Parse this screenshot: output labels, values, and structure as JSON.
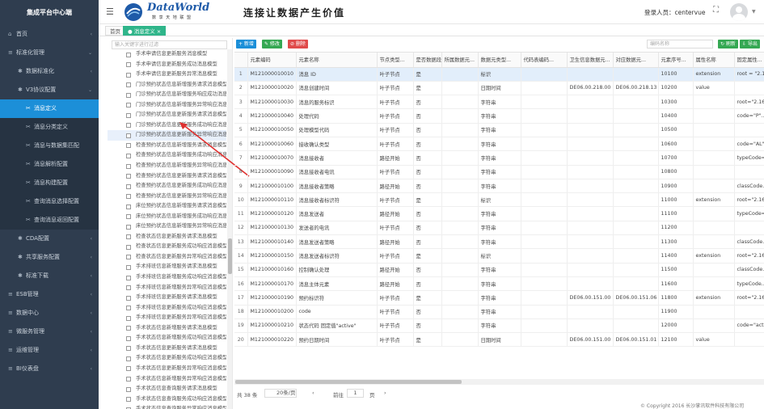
{
  "sidebar": {
    "brand": "集成平台中心端",
    "items": [
      {
        "label": "首页",
        "icon": "home-icon",
        "level": 1
      },
      {
        "label": "标准化管理",
        "icon": "list-icon",
        "level": 1,
        "expanded": true
      },
      {
        "label": "数据标准化",
        "icon": "gear-icon",
        "level": 2
      },
      {
        "label": "V3协议配置",
        "icon": "gear-icon",
        "level": 2,
        "expanded": true
      },
      {
        "label": "消息定义",
        "icon": "scissors-icon",
        "level": 3,
        "active": true
      },
      {
        "label": "消息分类定义",
        "icon": "scissors-icon",
        "level": 3
      },
      {
        "label": "消息与数据集匹配",
        "icon": "scissors-icon",
        "level": 3
      },
      {
        "label": "消息解析配置",
        "icon": "scissors-icon",
        "level": 3
      },
      {
        "label": "消息构建配置",
        "icon": "scissors-icon",
        "level": 3
      },
      {
        "label": "查询消息选择配置",
        "icon": "scissors-icon",
        "level": 3
      },
      {
        "label": "查询消息返回配置",
        "icon": "scissors-icon",
        "level": 3
      },
      {
        "label": "CDA配置",
        "icon": "gear-icon",
        "level": 2
      },
      {
        "label": "共享服务配置",
        "icon": "gear-icon",
        "level": 2
      },
      {
        "label": "标准下载",
        "icon": "gear-icon",
        "level": 2
      },
      {
        "label": "ESB管理",
        "icon": "list-icon",
        "level": 1
      },
      {
        "label": "数据中心",
        "icon": "list-icon",
        "level": 1
      },
      {
        "label": "微服务管理",
        "icon": "list-icon",
        "level": 1
      },
      {
        "label": "运维管理",
        "icon": "list-icon",
        "level": 1
      },
      {
        "label": "BI仪表盘",
        "icon": "list-icon",
        "level": 1
      }
    ]
  },
  "header": {
    "logo_text": "DataWorld",
    "logo_sub": "数 享 天 地 联 盟",
    "slogan": "连接让数据产生价值",
    "login_label": "登录人员：centervue"
  },
  "tabs": [
    {
      "label": "首页",
      "active": false
    },
    {
      "label": "● 消息定义 ×",
      "active": true
    }
  ],
  "tree": {
    "search_placeholder": "输入关键字进行过滤",
    "nodes": [
      "手术申请信息更新服务消息模型",
      "手术申请信息更新服务成功消息模型",
      "手术申请信息更新服务异常消息模型",
      "门诊预约状态信息新增服务请求消息模型",
      "门诊预约状态信息新增服务响应成功消息",
      "门诊预约状态信息新增服务异常响应消息",
      "门诊预约状态信息更新服务请求消息模型",
      "门诊预约状态信息更新服务成功响应消息",
      "门诊预约状态信息更新服务异常响应消息",
      "检查预约状态信息新增服务请求消息模型",
      "检查预约状态信息新增服务成功响应消息",
      "检查预约状态信息新增服务异常响应消息",
      "检查预约状态信息更新服务请求消息模型",
      "检查预约状态信息更新服务成功响应消息",
      "检查预约状态信息更新服务异常响应消息",
      "床位预约状态信息新增服务请求消息模型",
      "床位预约状态信息新增服务成功响应消息",
      "床位预约状态信息新增服务异常响应消息",
      "检查状态信息更新服务请求消息模型",
      "检查状态信息更新服务成功响应消息模型",
      "检查状态信息更新服务异常响应消息模型",
      "手术排班信息新增服务请求消息模型",
      "手术排班信息新增服务成功响应消息模型",
      "手术排班信息新增服务异常响应消息模型",
      "手术排班信息更新服务请求消息模型",
      "手术排班信息更新服务成功响应消息模型",
      "手术排班信息更新服务异常响应消息模型",
      "手术状态信息新增服务请求消息模型",
      "手术状态信息新增服务成功响应消息模型",
      "手术状态信息更新服务请求消息模型",
      "手术状态信息更新服务成功响应消息模型",
      "手术状态信息更新服务异常响应消息模型",
      "手术状态信息新增服务异常响应消息模型",
      "手术状态信息查询服务请求消息模型",
      "手术状态信息查询服务成功响应消息模型",
      "手术状态信息查询服务异常响应消息模型"
    ],
    "selected_index": 8
  },
  "toolbar": {
    "add": "+ 新增",
    "edit": "✎ 修改",
    "delete": "⊘ 删除",
    "search_placeholder": "编码名称",
    "refresh": "↻ 刷新",
    "export": "⇩ 导出"
  },
  "table": {
    "columns": [
      "",
      "元素编码",
      "元素名称",
      "节点类型...",
      "是否数据段...",
      "所属数据元...",
      "数据元类型...",
      "代码表编码...",
      "卫生信息数据元...",
      "对应数据元...",
      "元素序号...",
      "属性名称",
      "固定属性..."
    ],
    "rows": [
      [
        "1",
        "M121000010010",
        "消息 ID",
        "叶子节点",
        "是",
        "",
        "标识",
        "",
        "",
        "",
        "10100",
        "extension",
        "root = \"2.16..."
      ],
      [
        "2",
        "M121000010020",
        "消息创建时间",
        "叶子节点",
        "是",
        "",
        "日期时间",
        "",
        "DE06.00.218.00",
        "DE06.00.218.13",
        "10200",
        "value",
        ""
      ],
      [
        "3",
        "M121000010030",
        "消息的服务标识",
        "叶子节点",
        "否",
        "",
        "字符串",
        "",
        "",
        "",
        "10300",
        "",
        "root=\"2.16..."
      ],
      [
        "4",
        "M121000010040",
        "处理代码",
        "叶子节点",
        "否",
        "",
        "字符串",
        "",
        "",
        "",
        "10400",
        "",
        "code=\"P\"..."
      ],
      [
        "5",
        "M121000010050",
        "处理模型代码",
        "叶子节点",
        "否",
        "",
        "字符串",
        "",
        "",
        "",
        "10500",
        "",
        ""
      ],
      [
        "6",
        "M121000010060",
        "接收确认类型",
        "叶子节点",
        "否",
        "",
        "字符串",
        "",
        "",
        "",
        "10600",
        "",
        "code=\"AL\"..."
      ],
      [
        "7",
        "M121000010070",
        "消息接收者",
        "路径开始",
        "否",
        "",
        "字符串",
        "",
        "",
        "",
        "10700",
        "",
        "typeCode=..."
      ],
      [
        "8",
        "M121000010090",
        "消息接收者电讯",
        "叶子节点",
        "否",
        "",
        "字符串",
        "",
        "",
        "",
        "10800",
        "",
        ""
      ],
      [
        "9",
        "M121000010100",
        "消息接收者策略",
        "路径开始",
        "否",
        "",
        "字符串",
        "",
        "",
        "",
        "10900",
        "",
        "classCode..."
      ],
      [
        "10",
        "M121000010110",
        "消息接收者标识符",
        "叶子节点",
        "是",
        "",
        "标识",
        "",
        "",
        "",
        "11000",
        "extension",
        "root=\"2.16..."
      ],
      [
        "11",
        "M121000010120",
        "消息发送者",
        "路径开始",
        "否",
        "",
        "字符串",
        "",
        "",
        "",
        "11100",
        "",
        "typeCode=..."
      ],
      [
        "12",
        "M121000010130",
        "发送者的电讯",
        "叶子节点",
        "否",
        "",
        "字符串",
        "",
        "",
        "",
        "11200",
        "",
        ""
      ],
      [
        "13",
        "M121000010140",
        "消息发送者策略",
        "路径开始",
        "否",
        "",
        "字符串",
        "",
        "",
        "",
        "11300",
        "",
        "classCode..."
      ],
      [
        "14",
        "M121000010150",
        "消息发送者标识符",
        "叶子节点",
        "是",
        "",
        "标识",
        "",
        "",
        "",
        "11400",
        "extension",
        "root=\"2.16..."
      ],
      [
        "15",
        "M121000010160",
        "控制确认处理",
        "路径开始",
        "否",
        "",
        "字符串",
        "",
        "",
        "",
        "11500",
        "",
        "classCode..."
      ],
      [
        "16",
        "M121000010170",
        "消息主体元素",
        "路径开始",
        "否",
        "",
        "字符串",
        "",
        "",
        "",
        "11600",
        "",
        "typeCode..."
      ],
      [
        "17",
        "M121000010190",
        "预约标识符",
        "叶子节点",
        "是",
        "",
        "字符串",
        "",
        "DE06.00.151.00",
        "DE06.00.151.06",
        "11800",
        "extension",
        "root=\"2.16..."
      ],
      [
        "18",
        "M121000010200",
        "code",
        "叶子节点",
        "否",
        "",
        "字符串",
        "",
        "",
        "",
        "11900",
        "",
        ""
      ],
      [
        "19",
        "M121000010210",
        "状态代码 固定值\"active\"",
        "叶子节点",
        "否",
        "",
        "字符串",
        "",
        "",
        "",
        "12000",
        "",
        "code=\"acti..."
      ],
      [
        "20",
        "M121000010220",
        "预约日期时间",
        "叶子节点",
        "是",
        "",
        "日期时间",
        "",
        "DE06.00.151.00",
        "DE06.00.151.01",
        "12100",
        "value",
        ""
      ]
    ],
    "selected_row": 0
  },
  "pager": {
    "total": "共 38 条",
    "page_size": "20条/页",
    "prev": "前往",
    "page": "1",
    "page_suffix": "页"
  },
  "footer": {
    "copyright": "© Copyright 2016 长沙掌讯软件科技有限公司"
  },
  "colors": {
    "sidebar_bg": "#2f3d4f",
    "active_blue": "#1c8fd8",
    "tab_green": "#2fb58a",
    "btn_green": "#35a853",
    "btn_red": "#e04b4b",
    "arrow_red": "#e0302f"
  }
}
